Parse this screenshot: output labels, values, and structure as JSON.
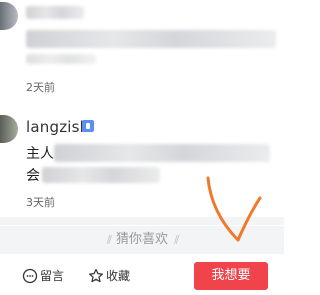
{
  "comments": [
    {
      "username": "",
      "time": "2天前",
      "text_lines": []
    },
    {
      "username": "langzisb",
      "time": "3天前",
      "text_lines": [
        "主人",
        "会"
      ]
    }
  ],
  "guess_section": {
    "label": "猜你喜欢"
  },
  "bottom_bar": {
    "comment_label": "留言",
    "favorite_label": "收藏",
    "want_label": "我想要"
  },
  "colors": {
    "accent": "#f0434a",
    "annotation": "#f07a2a",
    "vip_badge": "#5b8ff3"
  },
  "icons": {
    "comment": "chat-bubble-icon",
    "favorite": "star-outline-icon",
    "vip": "vip-badge-icon"
  }
}
